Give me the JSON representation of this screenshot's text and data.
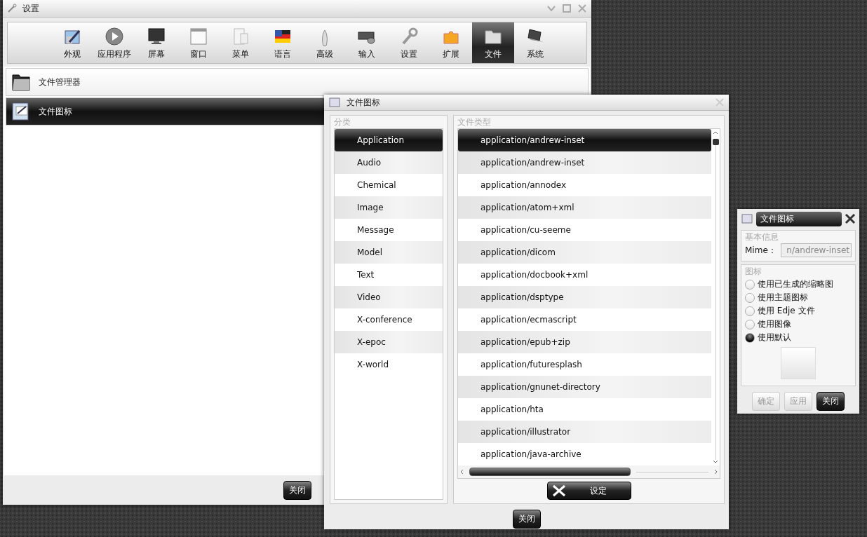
{
  "main_window": {
    "title": "设置",
    "toolbar": [
      {
        "label": "外观",
        "selected": false
      },
      {
        "label": "应用程序",
        "selected": false
      },
      {
        "label": "屏幕",
        "selected": false
      },
      {
        "label": "窗口",
        "selected": false
      },
      {
        "label": "菜单",
        "selected": false
      },
      {
        "label": "语言",
        "selected": false
      },
      {
        "label": "高级",
        "selected": false
      },
      {
        "label": "输入",
        "selected": false
      },
      {
        "label": "设置",
        "selected": false
      },
      {
        "label": "扩展",
        "selected": false
      },
      {
        "label": "文件",
        "selected": true
      },
      {
        "label": "系统",
        "selected": false
      }
    ],
    "categories": [
      {
        "label": "文件管理器",
        "selected": false
      },
      {
        "label": "文件图标",
        "selected": true
      }
    ],
    "close_button": "关闭"
  },
  "file_icons_window": {
    "title": "文件图标",
    "category_group": {
      "title": "分类",
      "items": [
        {
          "label": "Application",
          "selected": true
        },
        {
          "label": "Audio",
          "selected": false
        },
        {
          "label": "Chemical",
          "selected": false
        },
        {
          "label": "Image",
          "selected": false
        },
        {
          "label": "Message",
          "selected": false
        },
        {
          "label": "Model",
          "selected": false
        },
        {
          "label": "Text",
          "selected": false
        },
        {
          "label": "Video",
          "selected": false
        },
        {
          "label": "X-conference",
          "selected": false
        },
        {
          "label": "X-epoc",
          "selected": false
        },
        {
          "label": "X-world",
          "selected": false
        }
      ]
    },
    "type_group": {
      "title": "文件类型",
      "items": [
        {
          "label": "application/andrew-inset",
          "selected": true
        },
        {
          "label": "application/andrew-inset",
          "selected": false
        },
        {
          "label": "application/annodex",
          "selected": false
        },
        {
          "label": "application/atom+xml",
          "selected": false
        },
        {
          "label": "application/cu-seeme",
          "selected": false
        },
        {
          "label": "application/dicom",
          "selected": false
        },
        {
          "label": "application/docbook+xml",
          "selected": false
        },
        {
          "label": "application/dsptype",
          "selected": false
        },
        {
          "label": "application/ecmascript",
          "selected": false
        },
        {
          "label": "application/epub+zip",
          "selected": false
        },
        {
          "label": "application/futuresplash",
          "selected": false
        },
        {
          "label": "application/gnunet-directory",
          "selected": false
        },
        {
          "label": "application/hta",
          "selected": false
        },
        {
          "label": "application/illustrator",
          "selected": false
        },
        {
          "label": "application/java-archive",
          "selected": false
        }
      ]
    },
    "set_button": "设定",
    "close_button": "关闭"
  },
  "icon_editor": {
    "title": "文件图标",
    "info_group": {
      "title": "基本信息",
      "mime_label": "Mime：",
      "mime_value": "n/andrew-inset"
    },
    "icon_group": {
      "title": "图标",
      "options": [
        {
          "label": "使用已生成的缩略图",
          "selected": false
        },
        {
          "label": "使用主题图标",
          "selected": false
        },
        {
          "label": "使用 Edje 文件",
          "selected": false
        },
        {
          "label": "使用图像",
          "selected": false
        },
        {
          "label": "使用默认",
          "selected": true
        }
      ]
    },
    "buttons": [
      {
        "label": "确定",
        "disabled": true
      },
      {
        "label": "应用",
        "disabled": true
      },
      {
        "label": "关闭",
        "disabled": false
      }
    ]
  }
}
